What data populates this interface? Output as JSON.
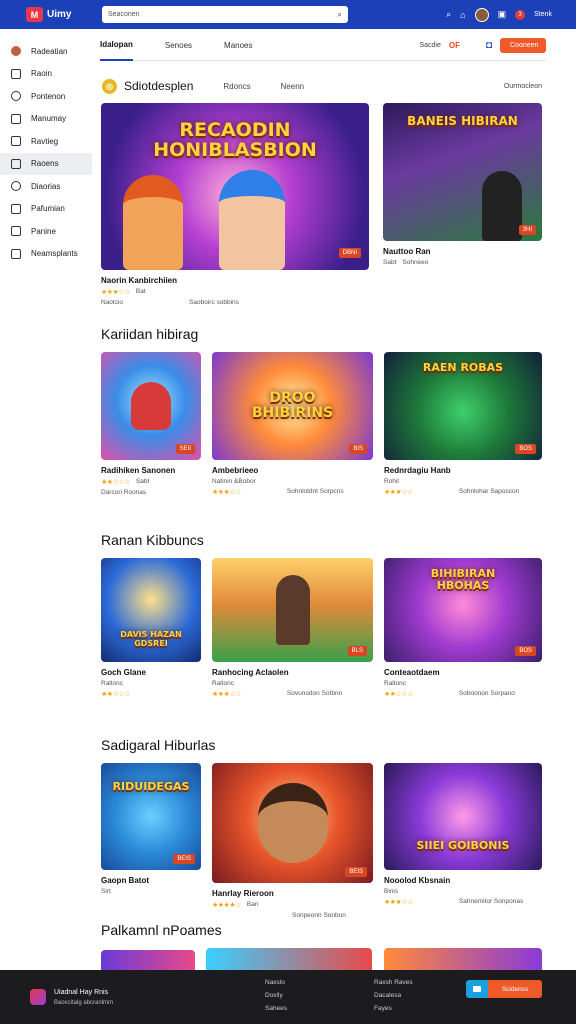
{
  "app": {
    "name": "Uimy",
    "logo_letter": "M"
  },
  "search": {
    "placeholder": "Seaconen"
  },
  "header": {
    "notif_count": "3",
    "user": "Stenk"
  },
  "sidebar": {
    "items": [
      {
        "label": "Radeatian",
        "icon": "avatar-icon"
      },
      {
        "label": "Raoin",
        "icon": "page-icon"
      },
      {
        "label": "Pontenon",
        "icon": "circle-icon"
      },
      {
        "label": "Manumay",
        "icon": "grid-icon"
      },
      {
        "label": "Ravtieg",
        "icon": "list-icon"
      },
      {
        "label": "Raoens",
        "icon": "folder-icon"
      },
      {
        "label": "Diaorias",
        "icon": "clock-icon"
      },
      {
        "label": "Pafumian",
        "icon": "chat-icon"
      },
      {
        "label": "Panine",
        "icon": "box-icon"
      },
      {
        "label": "Neamsplants",
        "icon": "doc-icon"
      }
    ]
  },
  "tabs": [
    {
      "label": "Idalopan"
    },
    {
      "label": "Senoes"
    },
    {
      "label": "Manoes"
    }
  ],
  "toolbar": {
    "sort_label": "Sacdie",
    "sort_value": "OF",
    "cta": "Cooneen"
  },
  "featured": {
    "title": "Sdiotdesplen",
    "tab1": "Rdoncs",
    "tab2": "Neenn",
    "more": "Ourmocleon",
    "cards": [
      {
        "art": "RECAODIN\nHONIBLASBION",
        "badge": "DBNI",
        "title": "Naorin Kanbirchiien",
        "stars": "★★★☆☆",
        "meta1": "Bat",
        "meta2": "Naotcio",
        "meta3": "Saoboirc sobbins"
      },
      {
        "art": "BANEIS HIBIRAN",
        "badge": "3HI",
        "title": "Nauttoo Ran",
        "stars": "",
        "meta1": "Sabt",
        "meta2": "Sohneeo",
        "meta3": ""
      }
    ]
  },
  "sections": [
    {
      "title": "Kariidan hibirag",
      "cards": [
        {
          "art": "",
          "badge": "SEII",
          "title": "Radihiken Sanonen",
          "stars": "★★☆☆☆",
          "meta1": "Sabt",
          "meta2": "Darcon Roonas"
        },
        {
          "art": "DROO\nBHIBIRINS",
          "badge": "BIS",
          "title": "Ambebrieeo",
          "stars": "★★★☆☆",
          "meta1": "Natinin &Bobor",
          "meta2": "Sohnlotdnt Sorpcns"
        },
        {
          "art": "RAEN ROBAS",
          "badge": "BOS",
          "title": "Rednrdagiu Hanb",
          "stars": "★★★☆☆",
          "meta1": "Rohil",
          "meta2": "Sohnlohar Saposcon"
        }
      ]
    },
    {
      "title": "Ranan Kibbuncs",
      "cards": [
        {
          "art": "DAVIS HAZAN\nGDSREI",
          "badge": "",
          "title": "Goch Glane",
          "stars": "★★☆☆☆",
          "meta1": "Raltonc",
          "meta2": ""
        },
        {
          "art": "",
          "badge": "BLS",
          "title": "Ranhocing Aclaolen",
          "stars": "★★★☆☆",
          "meta1": "Raltonc",
          "meta2": "Sovunodon Sotbnn"
        },
        {
          "art": "BIHIBIRAN\nHBOHAS",
          "badge": "BOS",
          "title": "Conteaotdaem",
          "stars": "★★☆☆☆",
          "meta1": "Raltonc",
          "meta2": "Soboonon Sorpano"
        }
      ]
    },
    {
      "title": "Sadigaral Hiburlas",
      "cards": [
        {
          "art": "RIDUIDEGAS",
          "badge": "BEIS",
          "title": "Gaopn Batot",
          "stars": "",
          "meta1": "Sirt",
          "meta2": ""
        },
        {
          "art": "",
          "badge": "BEIS",
          "title": "Hanrlay Rieroon",
          "stars": "★★★★☆",
          "meta1": "Ban",
          "meta2": "Sonpeonn Sonbon"
        },
        {
          "art": "SIIEI GOIBONIS",
          "badge": "",
          "title": "Nooolod Kbsnain",
          "stars": "★★★☆☆",
          "meta1": "Binis",
          "meta2": "Sahnemitor Sonponas"
        }
      ]
    },
    {
      "title": "Palkamnl nPoames"
    }
  ],
  "footer": {
    "app_title": "Uiadnal Hay Rnis",
    "app_sub": "Baoxcitalg abcranlmm",
    "col1": [
      "Naxslo",
      "Doxlly",
      "Sahees"
    ],
    "col2": [
      "Raxsh Raves",
      "Dacalesa",
      "Fayes"
    ],
    "btn": "Scidenss"
  },
  "colors": {
    "brand": "#1b40b8",
    "accent": "#f05a2a",
    "star": "#f2a20c"
  }
}
